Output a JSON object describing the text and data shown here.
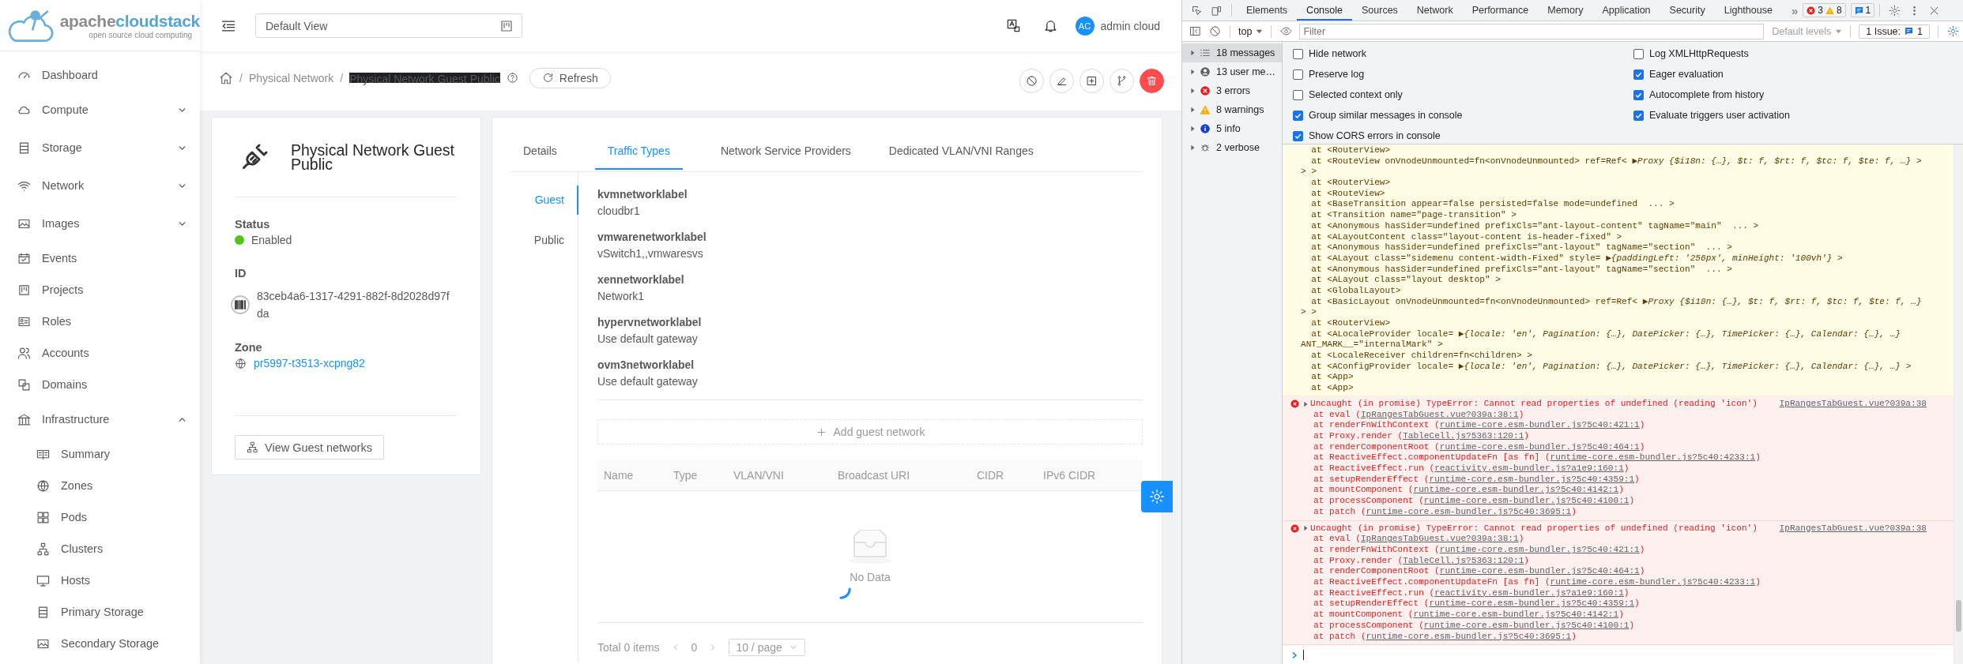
{
  "app": {
    "logo": {
      "brand_a": "apache",
      "brand_b": "cloudstack",
      "tagline": "open source cloud computing"
    },
    "sidebar": [
      {
        "label": "Dashboard",
        "kind": "link"
      },
      {
        "label": "Compute",
        "kind": "group",
        "expanded": false
      },
      {
        "label": "Storage",
        "kind": "group",
        "expanded": false
      },
      {
        "label": "Network",
        "kind": "group",
        "expanded": false
      },
      {
        "label": "Images",
        "kind": "group",
        "expanded": false
      },
      {
        "label": "Events",
        "kind": "link"
      },
      {
        "label": "Projects",
        "kind": "link"
      },
      {
        "label": "Roles",
        "kind": "link"
      },
      {
        "label": "Accounts",
        "kind": "link"
      },
      {
        "label": "Domains",
        "kind": "link"
      },
      {
        "label": "Infrastructure",
        "kind": "group",
        "expanded": true,
        "children": [
          {
            "label": "Summary"
          },
          {
            "label": "Zones"
          },
          {
            "label": "Pods"
          },
          {
            "label": "Clusters"
          },
          {
            "label": "Hosts"
          },
          {
            "label": "Primary Storage"
          },
          {
            "label": "Secondary Storage"
          }
        ]
      }
    ],
    "header": {
      "view_selector": "Default View",
      "user_initials": "AC",
      "user_name": "admin cloud"
    },
    "breadcrumb": [
      "Physical Network",
      "Physical Network Guest Public"
    ],
    "breadcrumb_separator": "/",
    "refresh_label": "Refresh",
    "details": {
      "title": "Physical Network Guest Public",
      "status_label": "Status",
      "status": "Enabled",
      "status_active": true,
      "id_label": "ID",
      "id": "83ceb4a6-1317-4291-882f-8d2028d97fda",
      "zone_label": "Zone",
      "zone": "pr5997-t3513-xcpng82",
      "action": "View Guest networks"
    },
    "tabs": [
      {
        "label": "Details",
        "selected": false
      },
      {
        "label": "Traffic Types",
        "selected": true
      },
      {
        "label": "Network Service Providers",
        "selected": false
      },
      {
        "label": "Dedicated VLAN/VNI Ranges",
        "selected": false
      }
    ],
    "traffic_types": [
      {
        "label": "Guest",
        "selected": true
      },
      {
        "label": "Public",
        "selected": false
      }
    ],
    "labels": [
      {
        "name": "kvmnetworklabel",
        "value": "cloudbr1"
      },
      {
        "name": "vmwarenetworklabel",
        "value": "vSwitch1,,vmwaresvs"
      },
      {
        "name": "xennetworklabel",
        "value": "Network1"
      },
      {
        "name": "hypervnetworklabel",
        "value": "Use default gateway"
      },
      {
        "name": "ovm3networklabel",
        "value": "Use default gateway"
      }
    ],
    "add_button": "Add guest network",
    "table": {
      "columns": [
        "Name",
        "Type",
        "VLAN/VNI",
        "Broadcast URI",
        "CIDR",
        "IPv6 CIDR"
      ],
      "loading": true,
      "empty_text": "No Data"
    },
    "pagination": {
      "total": "Total 0 items",
      "page": "0",
      "page_size": "10 / page"
    }
  },
  "devtools": {
    "tabs": [
      {
        "label": "Elements",
        "selected": false
      },
      {
        "label": "Console",
        "selected": true
      },
      {
        "label": "Sources",
        "selected": false
      },
      {
        "label": "Network",
        "selected": false
      },
      {
        "label": "Performance",
        "selected": false
      },
      {
        "label": "Memory",
        "selected": false
      },
      {
        "label": "Application",
        "selected": false
      },
      {
        "label": "Security",
        "selected": false
      },
      {
        "label": "Lighthouse",
        "selected": false
      }
    ],
    "more": "»",
    "badges": {
      "errors": "3",
      "warnings": "8",
      "issues": "1"
    },
    "toolbar": {
      "context": "top",
      "filter_placeholder": "Filter",
      "levels": "Default levels",
      "issues_label": "1 Issue:",
      "issues_count": "1"
    },
    "sidebar": [
      {
        "label": "18 messages",
        "kind": "all",
        "selected": true
      },
      {
        "label": "13 user me…",
        "kind": "user",
        "selected": false
      },
      {
        "label": "3 errors",
        "kind": "error",
        "selected": false
      },
      {
        "label": "8 warnings",
        "kind": "warning",
        "selected": false
      },
      {
        "label": "5 info",
        "kind": "info",
        "selected": false
      },
      {
        "label": "2 verbose",
        "kind": "verbose",
        "selected": false
      }
    ],
    "settings": [
      {
        "label": "Hide network",
        "checked": false
      },
      {
        "label": "Preserve log",
        "checked": false
      },
      {
        "label": "Selected context only",
        "checked": false
      },
      {
        "label": "Group similar messages in console",
        "checked": true
      },
      {
        "label": "Show CORS errors in console",
        "checked": true
      },
      {
        "label": "Log XMLHttpRequests",
        "checked": false
      },
      {
        "label": "Eager evaluation",
        "checked": true
      },
      {
        "label": "Autocomplete from history",
        "checked": true
      },
      {
        "label": "Evaluate triggers user activation",
        "checked": true
      }
    ],
    "warning_lines": [
      "  at <RouterView>",
      "  at <RouteView onVnodeUnmounted=fn<onVnodeUnmounted> ref=Ref< ▶*Proxy {$i18n: {…}, $t: f, $rt: f, $tc: f, $te: f, …}* >",
      "> >",
      "  at <RouterView>",
      "  at <RouteView>",
      "  at <BaseTransition appear=false persisted=false mode=undefined  ... >",
      "  at <Transition name=\"page-transition\" >",
      "  at <Anonymous hasSider=undefined prefixCls=\"ant-layout-content\" tagName=\"main\"  ... >",
      "  at <ALayoutContent class=\"layout-content is-header-fixed\" >",
      "  at <Anonymous hasSider=undefined prefixCls=\"ant-layout\" tagName=\"section\"  ... >",
      "  at <ALayout class=\"sidemenu content-width-Fixed\" style= ▶*{paddingLeft: '256px', minHeight: '100vh'}* >",
      "  at <Anonymous hasSider=undefined prefixCls=\"ant-layout\" tagName=\"section\"  ... >",
      "  at <ALayout class=\"layout desktop\" >",
      "  at <GlobalLayout>",
      "  at <BasicLayout onVnodeUnmounted=fn<onVnodeUnmounted> ref=Ref< ▶*Proxy {$i18n: {…}, $t: f, $rt: f, $tc: f, $te: f, …}*",
      "> >",
      "  at <RouterView>",
      "  at <ALocaleProvider locale= ▶*{locale: 'en', Pagination: {…}, DatePicker: {…}, TimePicker: {…}, Calendar: {…}, …}*",
      "ANT_MARK__=\"internalMark\" >",
      "  at <LocaleReceiver children=fn<children> >",
      "  at <AConfigProvider locale= ▶*{locale: 'en', Pagination: {…}, DatePicker: {…}, TimePicker: {…}, Calendar: {…}, …}* >",
      "  at <App>",
      "  at <App>"
    ],
    "errors": [
      {
        "message": "Uncaught (in promise) TypeError: Cannot read properties of undefined (reading 'icon')",
        "source": "IpRangesTabGuest.vue?039a:38",
        "frames": [
          {
            "call": "at eval (",
            "link": "IpRangesTabGuest.vue?039a:38:1",
            "end": ")"
          },
          {
            "call": "at renderFnWithContext (",
            "link": "runtime-core.esm-bundler.js?5c40:421:1",
            "end": ")"
          },
          {
            "call": "at Proxy.render (",
            "link": "TableCell.js?5363:120:1",
            "end": ")"
          },
          {
            "call": "at renderComponentRoot (",
            "link": "runtime-core.esm-bundler.js?5c40:464:1",
            "end": ")"
          },
          {
            "call": "at ReactiveEffect.componentUpdateFn [as fn] (",
            "link": "runtime-core.esm-bundler.js?5c40:4233:1",
            "end": ")"
          },
          {
            "call": "at ReactiveEffect.run (",
            "link": "reactivity.esm-bundler.js?a1e9:160:1",
            "end": ")"
          },
          {
            "call": "at setupRenderEffect (",
            "link": "runtime-core.esm-bundler.js?5c40:4359:1",
            "end": ")"
          },
          {
            "call": "at mountComponent (",
            "link": "runtime-core.esm-bundler.js?5c40:4142:1",
            "end": ")"
          },
          {
            "call": "at processComponent (",
            "link": "runtime-core.esm-bundler.js?5c40:4100:1",
            "end": ")"
          },
          {
            "call": "at patch (",
            "link": "runtime-core.esm-bundler.js?5c40:3695:1",
            "end": ")"
          }
        ]
      },
      {
        "message": "Uncaught (in promise) TypeError: Cannot read properties of undefined (reading 'icon')",
        "source": "IpRangesTabGuest.vue?039a:38",
        "frames": [
          {
            "call": "at eval (",
            "link": "IpRangesTabGuest.vue?039a:38:1",
            "end": ")"
          },
          {
            "call": "at renderFnWithContext (",
            "link": "runtime-core.esm-bundler.js?5c40:421:1",
            "end": ")"
          },
          {
            "call": "at Proxy.render (",
            "link": "TableCell.js?5363:120:1",
            "end": ")"
          },
          {
            "call": "at renderComponentRoot (",
            "link": "runtime-core.esm-bundler.js?5c40:464:1",
            "end": ")"
          },
          {
            "call": "at ReactiveEffect.componentUpdateFn [as fn] (",
            "link": "runtime-core.esm-bundler.js?5c40:4233:1",
            "end": ")"
          },
          {
            "call": "at ReactiveEffect.run (",
            "link": "reactivity.esm-bundler.js?a1e9:160:1",
            "end": ")"
          },
          {
            "call": "at setupRenderEffect (",
            "link": "runtime-core.esm-bundler.js?5c40:4359:1",
            "end": ")"
          },
          {
            "call": "at mountComponent (",
            "link": "runtime-core.esm-bundler.js?5c40:4142:1",
            "end": ")"
          },
          {
            "call": "at processComponent (",
            "link": "runtime-core.esm-bundler.js?5c40:4100:1",
            "end": ")"
          },
          {
            "call": "at patch (",
            "link": "runtime-core.esm-bundler.js?5c40:3695:1",
            "end": ")"
          }
        ]
      }
    ]
  }
}
